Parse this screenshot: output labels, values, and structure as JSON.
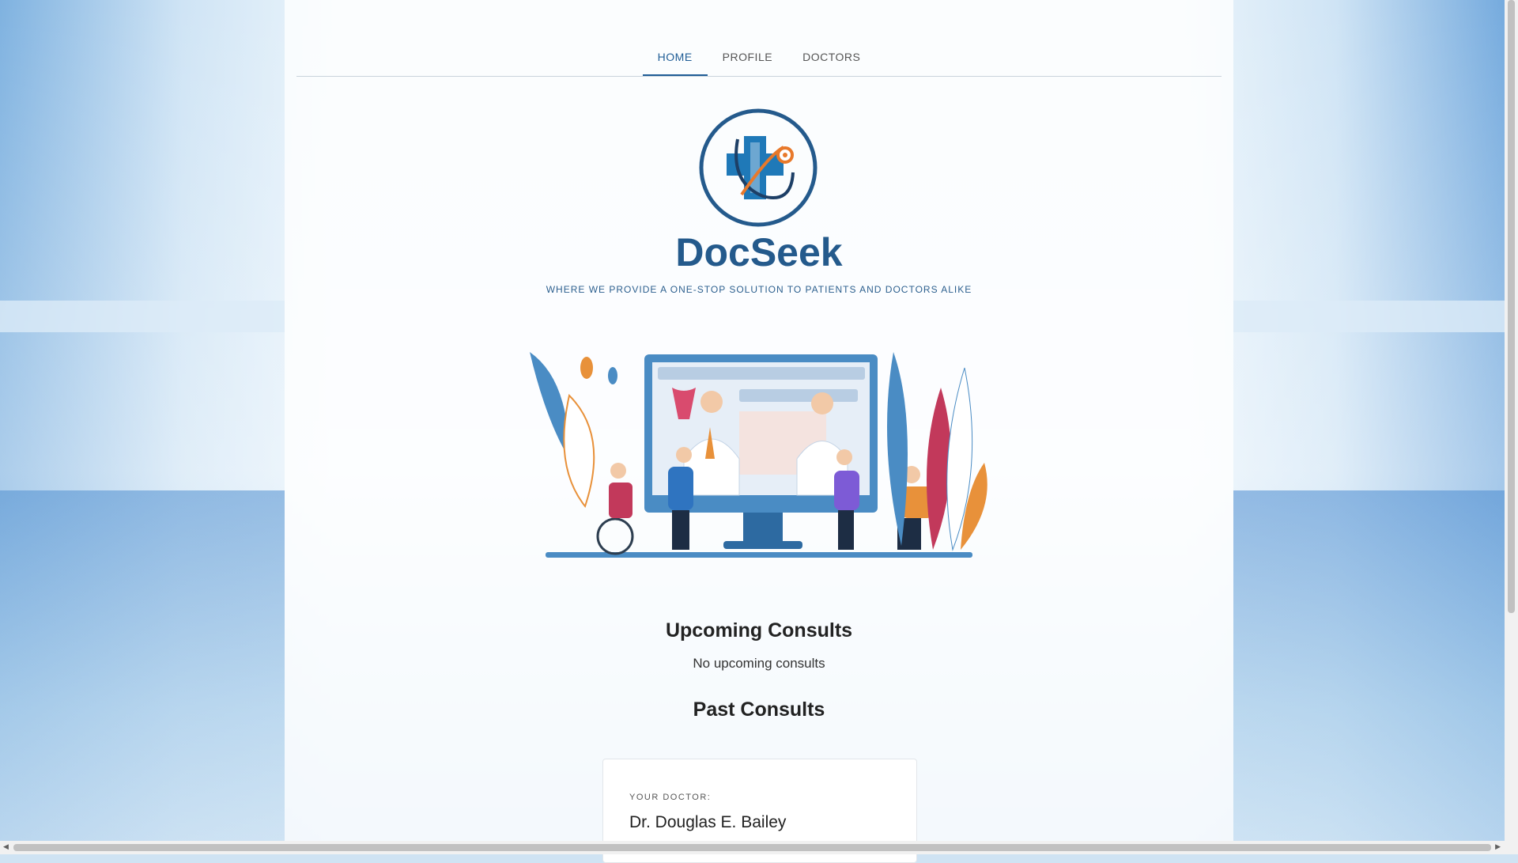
{
  "nav": {
    "items": [
      {
        "label": "HOME",
        "active": true
      },
      {
        "label": "PROFILE",
        "active": false
      },
      {
        "label": "DOCTORS",
        "active": false
      }
    ]
  },
  "brand": {
    "name": "DocSeek",
    "tagline": "WHERE WE PROVIDE A ONE-STOP SOLUTION TO PATIENTS AND DOCTORS ALIKE",
    "logo_icon": "medical-cross-stethoscope-icon"
  },
  "upcoming": {
    "title": "Upcoming Consults",
    "empty_text": "No upcoming consults"
  },
  "past": {
    "title": "Past Consults",
    "card": {
      "label": "YOUR DOCTOR:",
      "doctor": "Dr. Douglas E. Bailey"
    }
  },
  "colors": {
    "accent": "#1f5d96",
    "brand": "#245a8c"
  }
}
